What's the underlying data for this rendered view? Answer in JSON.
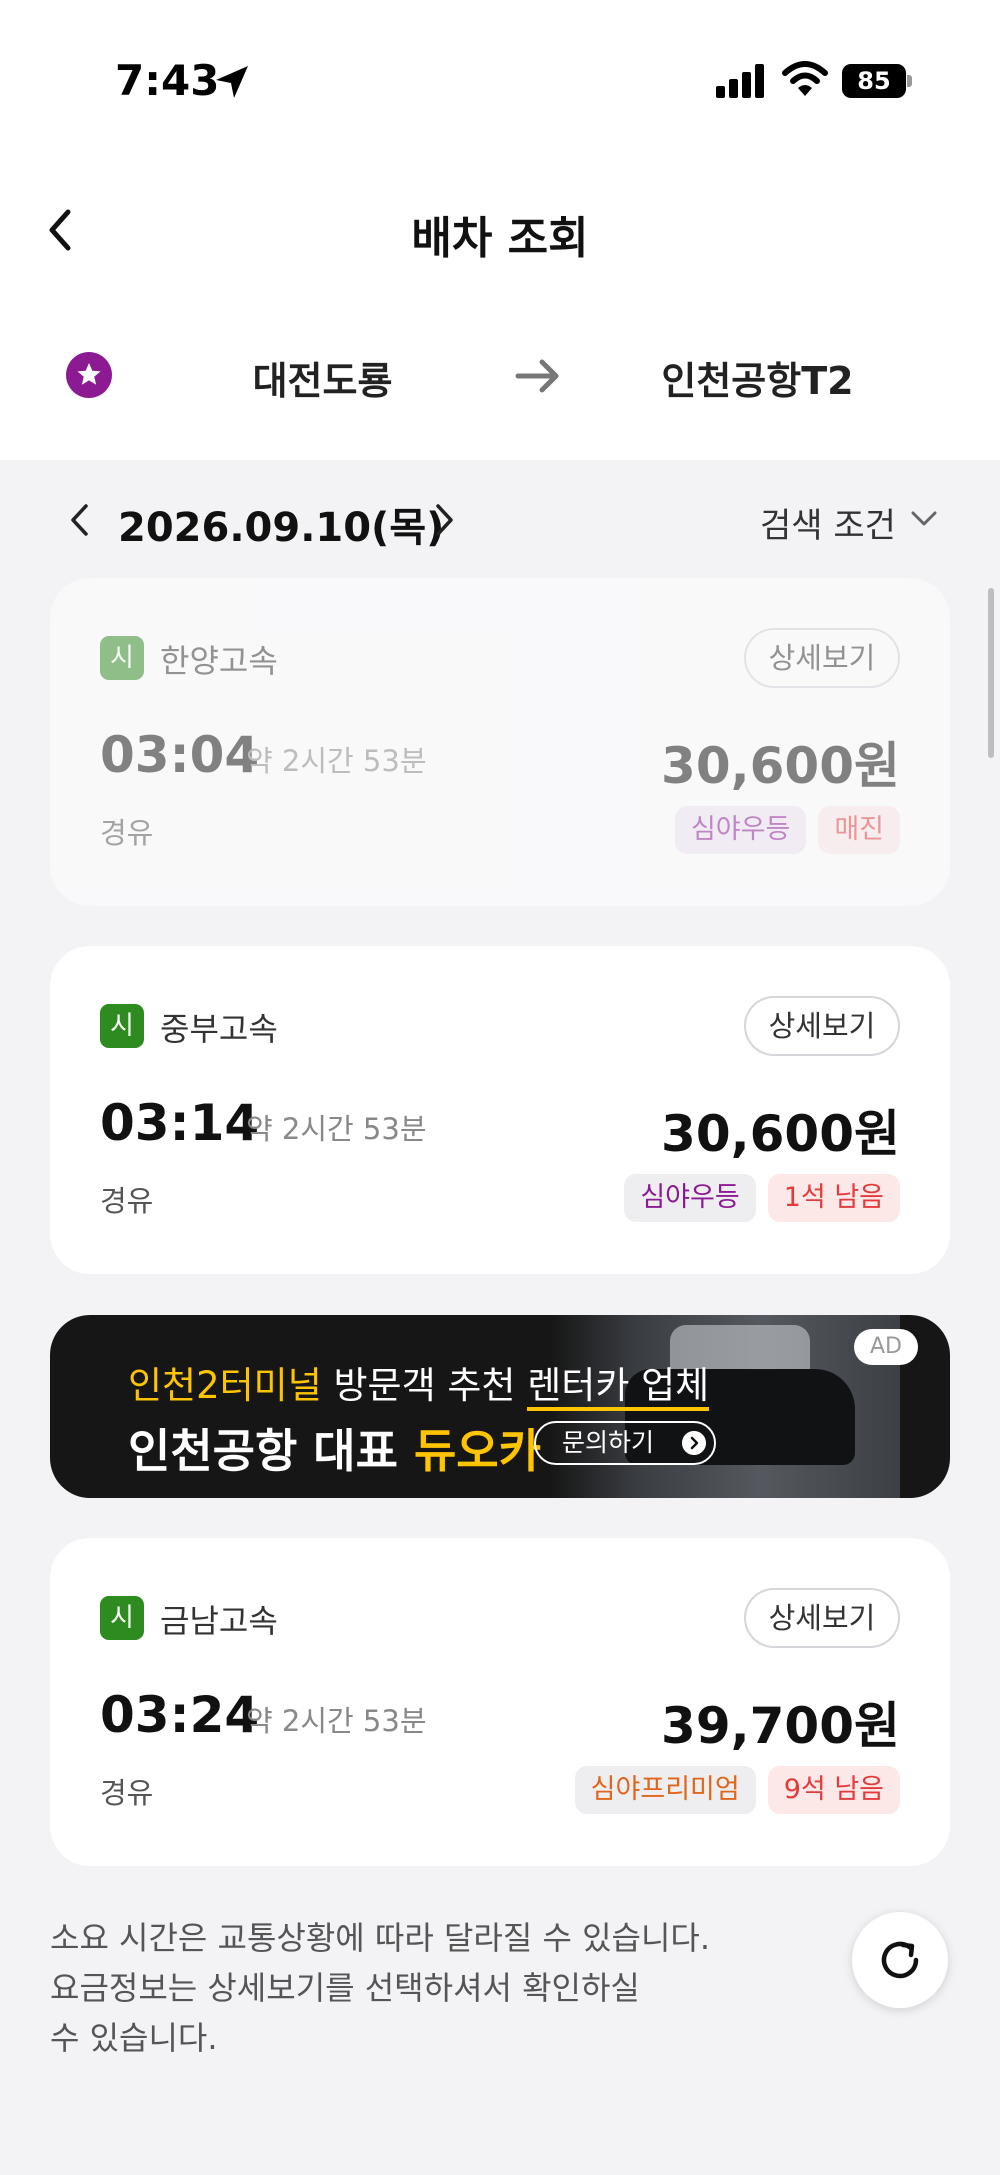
{
  "status_bar": {
    "time": "7:43",
    "battery": "85"
  },
  "header": {
    "title": "배차 조회"
  },
  "route": {
    "from": "대전도룡",
    "to": "인천공항T2"
  },
  "date": {
    "label": "2026.09.10(목)"
  },
  "filter": {
    "label": "검색 조건"
  },
  "cards": [
    {
      "badge": "시",
      "operator": "한양고속",
      "detail_label": "상세보기",
      "time": "03:04",
      "duration": "약 2시간 53분",
      "via": "경유",
      "price": "30,600원",
      "tags": [
        {
          "text": "심야우등",
          "bg": "#f1e6f2",
          "color": "#8c1b93"
        },
        {
          "text": "매진",
          "bg": "#fde8e8",
          "color": "#e23b3b"
        }
      ],
      "sold_out": true
    },
    {
      "badge": "시",
      "operator": "중부고속",
      "detail_label": "상세보기",
      "time": "03:14",
      "duration": "약 2시간 53분",
      "via": "경유",
      "price": "30,600원",
      "tags": [
        {
          "text": "심야우등",
          "bg": "#eeeef1",
          "color": "#8c1b93"
        },
        {
          "text": "1석 남음",
          "bg": "#fde8e8",
          "color": "#e23b3b"
        }
      ],
      "sold_out": false
    },
    {
      "badge": "시",
      "operator": "금남고속",
      "detail_label": "상세보기",
      "time": "03:24",
      "duration": "약 2시간 53분",
      "via": "경유",
      "price": "39,700원",
      "tags": [
        {
          "text": "심야프리미엄",
          "bg": "#eeeef1",
          "color": "#e0661b"
        },
        {
          "text": "9석 남음",
          "bg": "#fde8e8",
          "color": "#e23b3b"
        }
      ],
      "sold_out": false
    }
  ],
  "ad": {
    "line1_highlight": "인천2터미널",
    "line1_mid": " 방문객 추천 ",
    "line1_end": "렌터카 업체",
    "line2_start": "인천공항 대표 ",
    "line2_highlight": "듀오카",
    "cta": "문의하기",
    "badge": "AD"
  },
  "footer": {
    "note_line1": "소요 시간은 교통상황에 따라 달라질 수 있습니다.",
    "note_line2": "요금정보는 상세보기를 선택하셔서 확인하실",
    "note_line3": "수 있습니다."
  },
  "colors": {
    "route_badge": "#8c1b93",
    "operator_badge": "#2e8b1f",
    "ad_accent": "#ffc400"
  },
  "icons": [
    "location-arrow-icon",
    "signal-icon",
    "wifi-icon",
    "battery-icon",
    "back-icon",
    "star-icon",
    "arrow-right-icon",
    "chevron-left-icon",
    "chevron-right-icon",
    "chevron-down-icon",
    "refresh-icon"
  ]
}
